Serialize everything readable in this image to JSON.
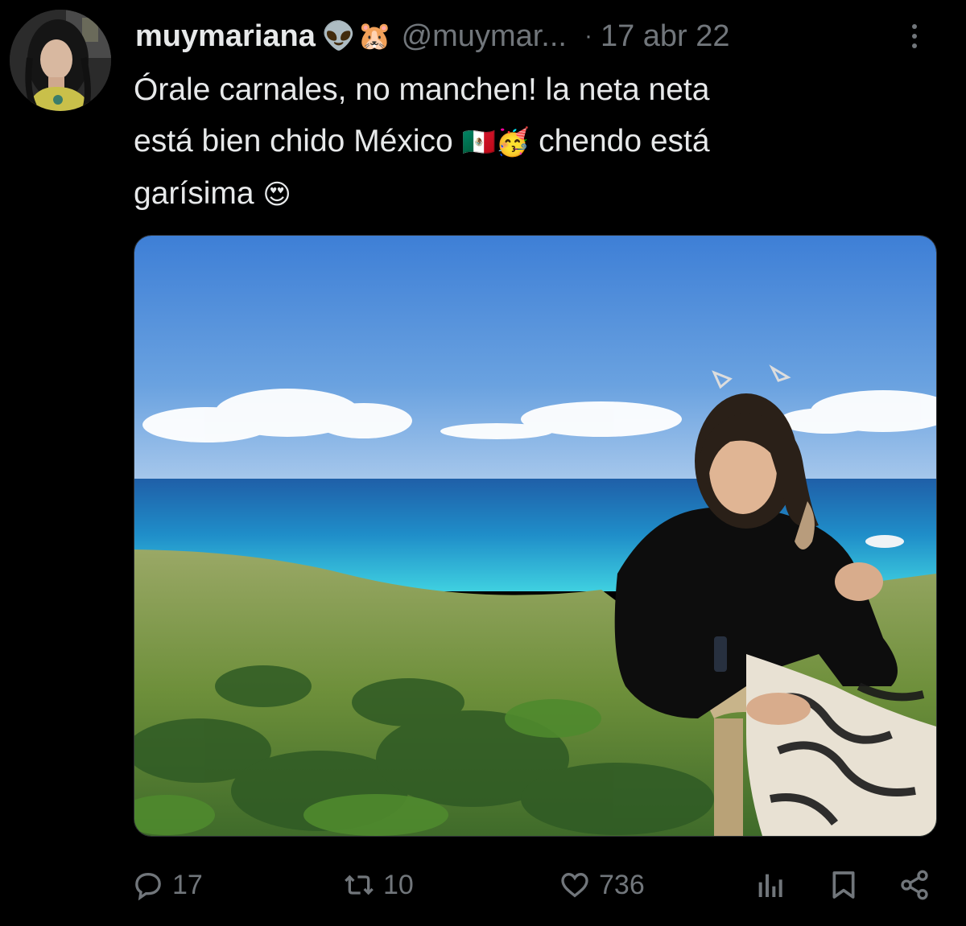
{
  "tweet": {
    "display_name": "muymariana",
    "name_emojis": [
      "👽",
      "🐹"
    ],
    "handle": "@muymar...",
    "separator": "·",
    "date": "17 abr 22",
    "text_line1": "Órale carnales, no manchen! la neta neta",
    "text_line2_a": "está bien chido México ",
    "text_line2_emojis": "🇲🇽🥳",
    "text_line2_b": " chendo está",
    "text_line3_a": "garísima ",
    "text_line3_emoji": "😍"
  },
  "actions": {
    "replies": "17",
    "retweets": "10",
    "likes": "736"
  },
  "icons": {
    "reply": "reply-icon",
    "retweet": "retweet-icon",
    "like": "heart-icon",
    "views": "analytics-icon",
    "bookmark": "bookmark-icon",
    "share": "share-icon",
    "more": "more-icon"
  },
  "colors": {
    "background": "#000000",
    "text": "#e7e9ea",
    "secondary": "#71767b"
  }
}
